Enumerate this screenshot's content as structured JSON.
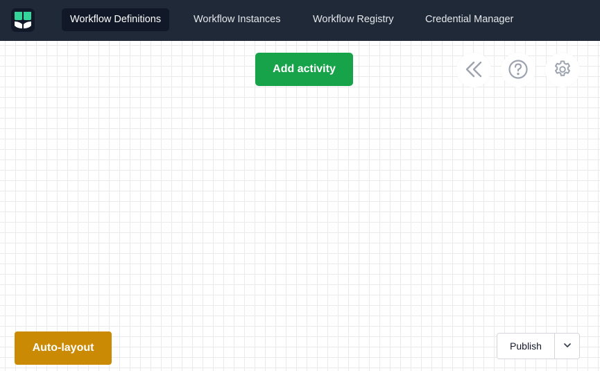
{
  "header": {
    "logo_icon": "elsa-leaf-logo-icon",
    "nav": [
      {
        "label": "Workflow Definitions",
        "active": true
      },
      {
        "label": "Workflow Instances",
        "active": false
      },
      {
        "label": "Workflow Registry",
        "active": false
      },
      {
        "label": "Credential Manager",
        "active": false
      }
    ]
  },
  "toolbar": {
    "add_activity_label": "Add activity",
    "collapse_icon": "chevrons-left-icon",
    "help_icon": "question-circle-icon",
    "settings_icon": "gear-icon"
  },
  "footer": {
    "auto_layout_label": "Auto-layout",
    "publish_label": "Publish",
    "publish_menu_icon": "chevron-down-icon"
  },
  "colors": {
    "header_bg": "#1f2937",
    "nav_active_bg": "#111827",
    "add_activity_bg": "#16a34a",
    "auto_layout_bg": "#ca8a04",
    "logo_green": "#34d399"
  }
}
